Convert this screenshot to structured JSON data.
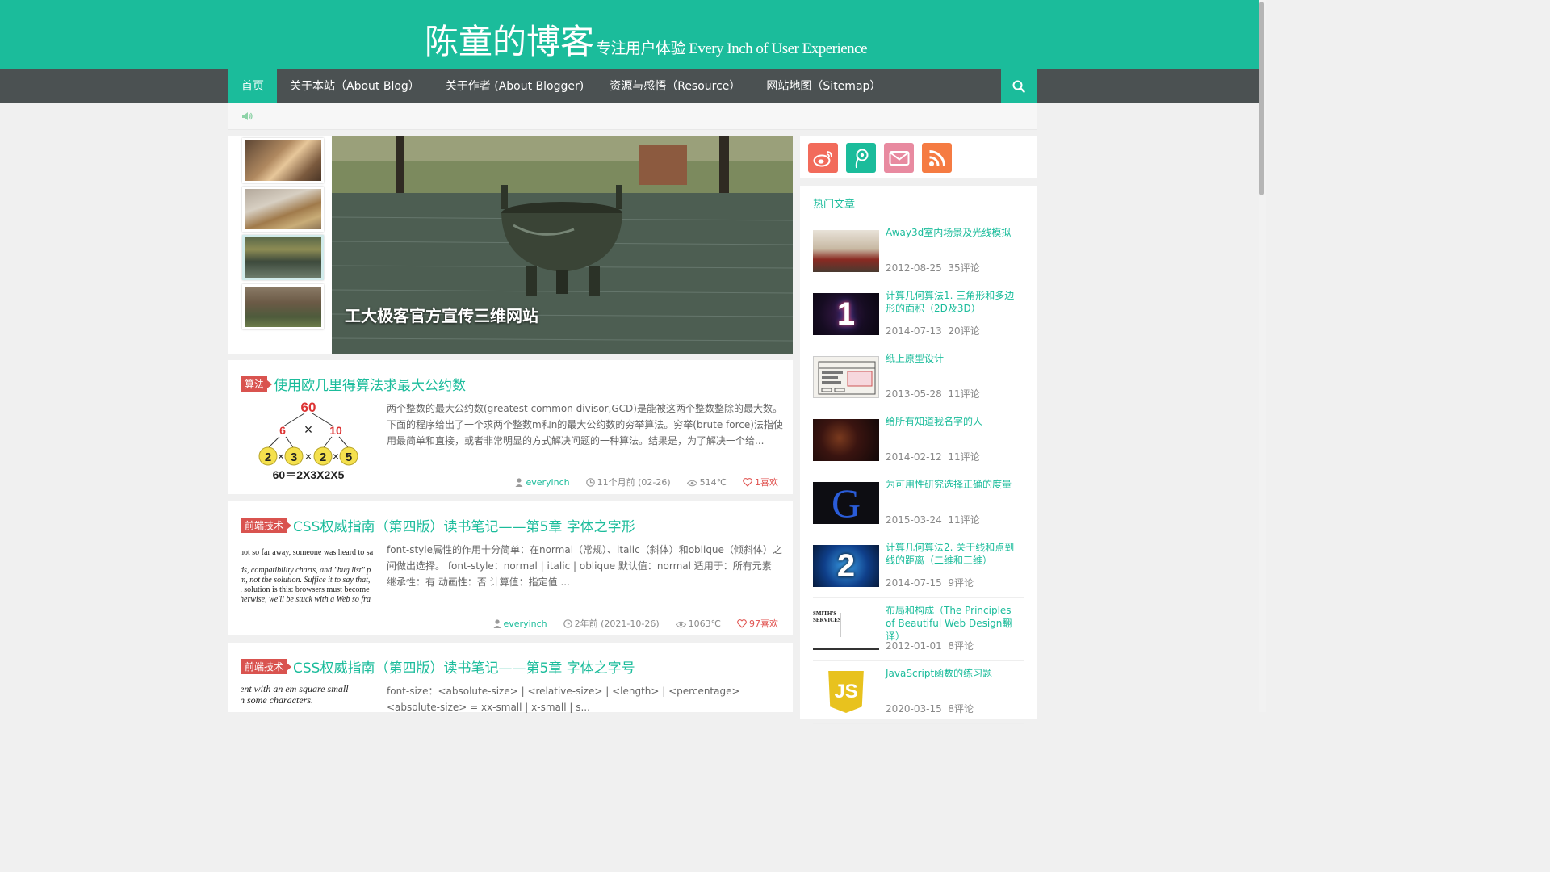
{
  "site": {
    "title": "陈童的博客",
    "subtitle": "专注用户体验 Every Inch of User Experience"
  },
  "nav": {
    "items": [
      {
        "label": "首页",
        "active": true
      },
      {
        "label": "关于本站（About Blog）"
      },
      {
        "label": "关于作者 (About Blogger)"
      },
      {
        "label": "资源与感悟（Resource）"
      },
      {
        "label": "网站地图（Sitemap）"
      }
    ],
    "search_icon": "search-icon"
  },
  "notice": {
    "icon": "speaker-icon"
  },
  "slider": {
    "caption": "工大极客官方宣传三维网站",
    "active_thumb": 3
  },
  "posts": [
    {
      "category": "算法",
      "title": "使用欧几里得算法求最大公约数",
      "excerpt": "两个整数的最大公约数(greatest common divisor,GCD)是能被这两个整数整除的最大数。下面的程序给出了一个求两个整数m和n的最大公约数的穷举算法。穷举(brute force)法指使用最简单和直接，或者非常明显的方式解决问题的一种算法。结果是，为了解决一个给...",
      "image": {
        "top": "60",
        "mid_left": "6",
        "mid_right": "10",
        "mid_op": "×",
        "leaves": [
          "2",
          "3",
          "2",
          "5"
        ],
        "ops": [
          "×",
          "×",
          "×"
        ],
        "bottom": "60＝2X3X2X5"
      },
      "author": "everyinch",
      "time": "11个月前 (02-26)",
      "views": "514℃",
      "likes": "1喜欢"
    },
    {
      "category": "前端技术",
      "title": "CSS权威指南（第四版）读书笔记——第5章 字体之字形",
      "excerpt": "font-style属性的作用十分简单：在normal（常规）、italic（斜体）和oblique（倾斜体）之间做出选择。 font-style：normal | italic | oblique 默认值：normal 适用于：所有元素 继承性：有 动画性：否 计算值：指定值 ...",
      "image": {
        "lines": [
          "not so far away, someone was heard to sa",
          "ds, compatibility charts, and \"bug list\" p",
          "m, not the solution. Suffice it to say that,",
          "l solution is this: browsers must become",
          "herwise, we'll be stuck with a Web so fra"
        ]
      },
      "author": "everyinch",
      "time": "2年前 (2021-10-26)",
      "views": "1063℃",
      "likes": "97喜欢"
    },
    {
      "category": "前端技术",
      "title": "CSS权威指南（第四版）读书笔记——第5章 字体之字号",
      "excerpt": "font-size：<absolute-size> | <relative-size> | <length> | <percentage> <absolute-size> = xx-small | x-small | s...",
      "image": {
        "lines": [
          "ent with an em square small",
          "n some characters."
        ]
      }
    }
  ],
  "social": [
    {
      "icon": "weibo-icon",
      "color": "#f26b5b"
    },
    {
      "icon": "tencent-weibo-icon",
      "color": "#1bbc9b"
    },
    {
      "icon": "mail-icon",
      "color": "#e88aa0"
    },
    {
      "icon": "rss-icon",
      "color": "#f57b42"
    }
  ],
  "hot": {
    "title": "热门文章",
    "items": [
      {
        "title": "Away3d室内场景及光线模拟",
        "date": "2012-08-25",
        "comments": "35评论"
      },
      {
        "title": "计算几何算法1. 三角形和多边形的面积（2D及3D）",
        "date": "2014-07-13",
        "comments": "20评论",
        "thumb_text": "1"
      },
      {
        "title": "纸上原型设计",
        "date": "2013-05-28",
        "comments": "11评论"
      },
      {
        "title": "给所有知道我名字的人",
        "date": "2014-02-12",
        "comments": "11评论"
      },
      {
        "title": "为可用性研究选择正确的度量",
        "date": "2015-03-24",
        "comments": "11评论",
        "thumb_text": "G"
      },
      {
        "title": "计算几何算法2. 关于线和点到线的距离（二维和三维）",
        "date": "2014-07-15",
        "comments": "9评论",
        "thumb_text": "2"
      },
      {
        "title": "布局和构成（The Principles of Beautiful Web Design翻译）",
        "date": "2012-01-01",
        "comments": "8评论",
        "thumb_text": "SMITH'S SERVICES"
      },
      {
        "title": "JavaScript函数的练习题",
        "date": "2020-03-15",
        "comments": "8评论",
        "thumb_text": "JS"
      }
    ]
  },
  "colors": {
    "accent": "#1bbc9b",
    "nav": "#4b5152",
    "category": "#d9534f",
    "like": "#e0524f"
  }
}
